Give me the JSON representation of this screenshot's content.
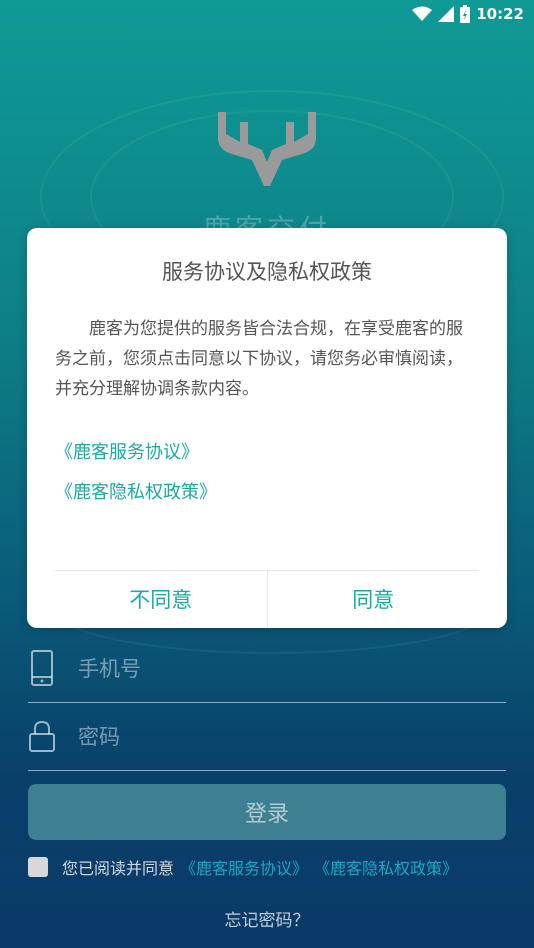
{
  "status_bar": {
    "time": "10:22"
  },
  "app": {
    "name": "鹿客交付"
  },
  "login": {
    "phone_placeholder": "手机号",
    "password_placeholder": "密码",
    "login_label": "登录",
    "agree_prefix": "您已阅读并同意",
    "service_link": "《鹿客服务协议》",
    "privacy_link": "《鹿客隐私权政策》",
    "forgot_label": "忘记密码？"
  },
  "dialog": {
    "title": "服务协议及隐私权政策",
    "body": "鹿客为您提供的服务皆合法合规，在享受鹿客的服务之前，您须点击同意以下协议，请您务必审慎阅读，并充分理解协调条款内容。",
    "service_link": "《鹿客服务协议》",
    "privacy_link": "《鹿客隐私权政策》",
    "disagree_label": "不同意",
    "agree_label": "同意"
  },
  "colors": {
    "accent": "#1aa9a3",
    "link": "#1aa9c8"
  }
}
